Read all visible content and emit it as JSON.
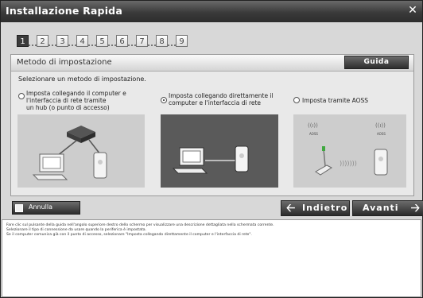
{
  "window": {
    "title": "Installazione Rapida",
    "close_glyph": "✕"
  },
  "steps": [
    "1",
    "2",
    "3",
    "4",
    "5",
    "6",
    "7",
    "8",
    "9"
  ],
  "active_step": "1",
  "panel": {
    "heading": "Metodo di impostazione",
    "help_label": "Guida",
    "instruction": "Selezionare un metodo di impostazione.",
    "options": [
      {
        "line1": "Imposta collegando il computer e",
        "line2": "l'interfaccia di rete tramite",
        "line3": "un hub (o punto di accesso)",
        "selected": false,
        "icon": "computer-hub-device-illustration"
      },
      {
        "line1": "Imposta collegando direttamente il",
        "line2": "computer e l'interfaccia di rete",
        "line3": "",
        "selected": true,
        "icon": "computer-direct-device-illustration"
      },
      {
        "line1": "Imposta tramite AOSS",
        "line2": "",
        "line3": "",
        "selected": false,
        "icon": "aoss-wireless-illustration"
      }
    ],
    "aoss_badges": [
      "AOSS",
      "AOSS"
    ]
  },
  "footer_buttons": {
    "cancel_label": "Annulla",
    "back_label": "Indietro",
    "next_label": "Avanti",
    "back_icon": "arrow-left-icon",
    "next_icon": "arrow-right-icon"
  },
  "description_lines": [
    "Fare clic sul pulsante della guida nell'angolo superiore destro dello schermo per visualizzare una descrizione dettagliata nella schermata corrente.",
    "Selezionare il tipo di connessione da usare quando la periferica è impostata.",
    "Se il computer comunica già con il punto di accesso, selezionare \"Imposta collegando direttamente il computer e l'interfaccia di rete\"."
  ],
  "colors": {
    "titlebar": "#3a3a3a",
    "selected_panel": "#5a5a5a",
    "panel_bg": "#e9e9e9"
  }
}
